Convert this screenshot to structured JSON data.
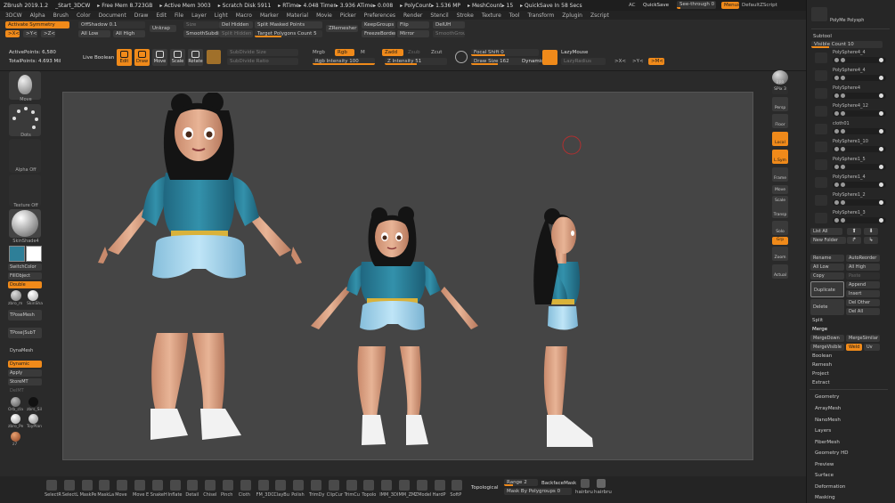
{
  "titlebar": {
    "app": "ZBrush 2019.1.2",
    "doc": "_Start_3DCW",
    "stats": [
      "▸ Free Mem 8.723GB",
      "▸ Active Mem 3003",
      "▸ Scratch Disk 5911",
      "▸ RTime▸ 4.048 Timer▸ 3.936 ATime▸ 0.008",
      "▸ PolyCount▸ 1.536 MP",
      "▸ MeshCount▸ 15",
      "▸ QuickSave In 58 Secs"
    ],
    "ac": "AC",
    "quicksave": "QuickSave",
    "seethrough": "See-through",
    "seethrough_val": "0",
    "menus_btn": "Menus",
    "default_script": "DefaultZScript"
  },
  "menubar": [
    "3DCW",
    "Alpha",
    "Brush",
    "Color",
    "Document",
    "Draw",
    "Edit",
    "File",
    "Layer",
    "Light",
    "Macro",
    "Marker",
    "Material",
    "Movie",
    "Picker",
    "Preferences",
    "Render",
    "Stencil",
    "Stroke",
    "Texture",
    "Tool",
    "Transform",
    "Zplugin",
    "Zscript"
  ],
  "topcontrols": {
    "activate_symmetry": "Activate Symmetry",
    "offshadow": "OffShadow 0.1",
    "x": ">X<",
    "y": ">Y<",
    "z": ">Z<",
    "all_low": "All Low",
    "all_high": "All High",
    "unkrap": "Unkrap",
    "size": "Size",
    "smoothsubdiv": "SmoothSubdiv",
    "del_hidden": "Del Hidden",
    "split_hidden": "Split Hidden",
    "split_masked": "Split Masked Points",
    "target_polygons": "Target Polygons Count",
    "target_polygons_val": "5",
    "zremesher": "ZRemesher",
    "keepgroups": "KeepGroups",
    "freezeborder": "FreezeBorder",
    "flip": "Flip",
    "mirror": "Mirror",
    "deluh": "DelUH",
    "smoothgroups": "SmoothGroups"
  },
  "toolshelf": {
    "active_points": "ActivePoints: 6,580",
    "total_points": "TotalPoints: 4.693 Mil",
    "live_boolean": "Live Boolean",
    "edit": "Edit",
    "draw": "Draw",
    "move": "Move",
    "scale": "Scale",
    "rotate": "Rotate",
    "subdivide_size": "SubDivide Size",
    "subdivide_ratio": "SubDivide Ratio",
    "mrgb": "Mrgb",
    "rgb": "Rgb",
    "m": "M",
    "rgb_intensity": "Rgb Intensity",
    "rgb_intensity_val": "100",
    "zadd": "Zadd",
    "zsub": "Zsub",
    "zcut": "Zcut",
    "z_intensity": "Z Intensity",
    "z_intensity_val": "51",
    "focal_shift": "Focal Shift",
    "focal_shift_val": "0",
    "draw_size": "Draw Size",
    "draw_size_val": "162",
    "dynamic": "Dynamic",
    "lazymouse": "LazyMouse",
    "lazyradius": "LazyRadius",
    "px": ">X<",
    "py": ">Y<",
    "pz": ">Z<",
    "pm": ">M<"
  },
  "left": {
    "brush": "Move",
    "stroke": "Dots",
    "alpha": "Alpha Off",
    "texture": "Texture Off",
    "material": "SkinShade4",
    "switchcolor": "SwitchColor",
    "fillobject": "FillObject",
    "double": "Double",
    "mat1": "zbro_m",
    "mat2": "SkinSha",
    "tposemesh": "TPoseMesh",
    "tposesubt": "TPose|SubT",
    "dynamesh": "DynaMesh",
    "dynamic": "Dynamic",
    "apply": "Apply",
    "storemt": "StoreMT",
    "delmt": "DelMT",
    "orb": "Orb_cla",
    "zbrs": "zbrs_Sil",
    "zbro_pe": "zbro_Pe",
    "toyplan": "ToyPlan",
    "z7": "z7"
  },
  "rightshelf": [
    "BPR",
    "SPix 3",
    "Persp",
    "Floor",
    "Local",
    "L.Sym",
    "Frame",
    "Move",
    "Scale",
    "Rotate",
    "Transp",
    "Solo",
    "Grp",
    "Zoom",
    "Actual"
  ],
  "rightpanel": {
    "polymesh": "PolyMe Polysph",
    "subtool": "Subtool",
    "visible_count": "Visible Count",
    "visible_count_val": "10",
    "subtools": [
      "PolySphere4_4",
      "PolySphere4_4",
      "PolySphere4",
      "PolySphere4_12",
      "cloth01",
      "PolySphere1_10",
      "PolySphere1_5",
      "PolySphere1_4",
      "PolySphere1_2",
      "PolySphere1_3"
    ],
    "list_all": "List All",
    "new_folder": "New Folder",
    "rename": "Rename",
    "autoreorder": "AutoReorder",
    "all_low": "All Low",
    "all_high": "All High",
    "copy": "Copy",
    "paste": "Paste",
    "duplicate": "Duplicate",
    "append": "Append",
    "insert": "Insert",
    "delete": "Delete",
    "del_other": "Del Other",
    "del_all": "Del All",
    "split": "Split",
    "merge": "Merge",
    "mergedown": "MergeDown",
    "mergesimilar": "MergeSimilar",
    "mergevisible": "MergeVisible",
    "weld": "Weld",
    "uv": "Uv",
    "boolean": "Boolean",
    "remesh": "Remesh",
    "project": "Project",
    "extract": "Extract",
    "sections": [
      "Geometry",
      "ArrayMesh",
      "NanoMesh",
      "Layers",
      "FiberMesh",
      "Geometry HD",
      "Preview",
      "Surface",
      "Deformation",
      "Masking"
    ]
  },
  "bottombar": {
    "brushes": [
      "SelectR",
      "SelectL",
      "MaskPe",
      "MaskLa",
      "Move",
      "Move E",
      "SnakeH",
      "Inflate",
      "Detail",
      "Chisel",
      "Pinch",
      "Cloth",
      "FM_3DC",
      "ClayBu",
      "Polish",
      "TrimDy",
      "ClipCur",
      "TrimCu",
      "Topolo",
      "IMM_3D",
      "IMM_ZM",
      "ZModel",
      "HardP",
      "SoftP"
    ],
    "topological": "Topological",
    "range": "Range",
    "range_val": "2",
    "backfacemask": "BackfaceMask",
    "mask_by_polygroups": "Mask By Polygroups",
    "mask_by_polygroups_val": "0",
    "hairbru1": "hairbru",
    "hairbru2": "hairbru"
  },
  "colors": {
    "accent": "#f08a1a",
    "bg": "#2a2a2a",
    "canvas": "#454545",
    "skin": "#e0a88a",
    "shirt": "#2e7f98",
    "shorts": "#9fd3ec",
    "hair": "#1a1a1a"
  }
}
